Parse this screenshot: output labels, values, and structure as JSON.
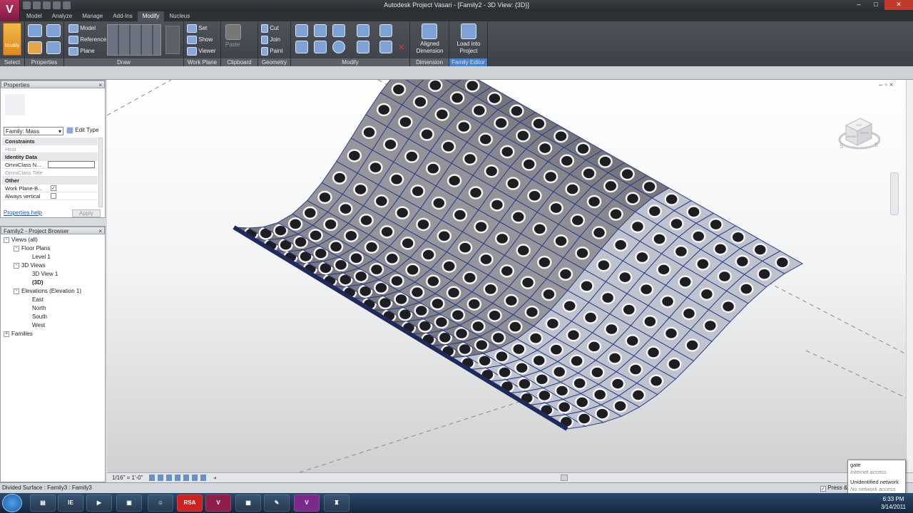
{
  "app": {
    "title": "Autodesk Project Vasari - [Family2 - 3D View: {3D}]",
    "logo": "V",
    "accent": "#8b1f4a"
  },
  "tabs": [
    "Model",
    "Analyze",
    "Manage",
    "Add-Ins",
    "Modify",
    "Nucleus"
  ],
  "ribbon": {
    "modify_label": "Modify",
    "panels": {
      "select": "Select",
      "properties": "Properties",
      "draw": "Draw",
      "work_plane": "Work Plane",
      "clipboard": "Clipboard",
      "geometry": "Geometry",
      "modify": "Modify",
      "dimension": "Dimension",
      "family_editor": "Family Editor"
    },
    "draw_items": [
      "Model",
      "Reference",
      "Plane"
    ],
    "workplane_items": [
      "Set",
      "Show",
      "Viewer"
    ],
    "clipboard_items": [
      "Paste"
    ],
    "geometry_items": [
      "Cut",
      "Join",
      "Paint"
    ],
    "aligned_dimension": "Aligned\nDimension",
    "load_into_project": "Load into\nProject"
  },
  "properties": {
    "header": "Properties",
    "type_selector": "Family: Mass",
    "edit_type": "Edit Type",
    "rows": [
      {
        "label": "Constraints",
        "group": true
      },
      {
        "label": "Host",
        "gray": true
      },
      {
        "label": "Identity Data",
        "group": true
      },
      {
        "label": "OmniClass N..."
      },
      {
        "label": "OmniClass Title",
        "gray": true
      },
      {
        "label": "Other",
        "group": true
      },
      {
        "label": "Work Plane-B...",
        "checked": true
      },
      {
        "label": "Always vertical",
        "checked": false
      }
    ],
    "help": "Properties help",
    "apply": "Apply"
  },
  "browser": {
    "header": "Family2 - Project Browser",
    "nodes": [
      {
        "label": "Views (all)",
        "level": 0,
        "toggle": "-"
      },
      {
        "label": "Floor Plans",
        "level": 1,
        "toggle": "-"
      },
      {
        "label": "Level 1",
        "level": 2
      },
      {
        "label": "3D Views",
        "level": 1,
        "toggle": "-"
      },
      {
        "label": "3D View 1",
        "level": 2
      },
      {
        "label": "(3D)",
        "level": 2,
        "bold": true
      },
      {
        "label": "Elevations (Elevation 1)",
        "level": 1,
        "toggle": "-"
      },
      {
        "label": "East",
        "level": 2
      },
      {
        "label": "North",
        "level": 2
      },
      {
        "label": "South",
        "level": 2
      },
      {
        "label": "West",
        "level": 2
      },
      {
        "label": "Families",
        "level": 0,
        "toggle": "+"
      }
    ]
  },
  "viewbar": {
    "scale": "1/16\" = 1'-0\""
  },
  "status": {
    "text": "Divided Surface : Family3 : Family3",
    "press_drag": "Press & Drag"
  },
  "viewcube": {
    "faces": [
      "TOP",
      "FRONT",
      "RIGHT"
    ],
    "compass": [
      "S",
      "E"
    ]
  },
  "network_tip": {
    "line1": "gate",
    "line2": "Internet access",
    "line3": "Unidentified network",
    "line4": "No network access"
  },
  "taskbar": {
    "apps": [
      "IE",
      "Media",
      "Folder",
      "Game",
      "RSA",
      "Vasari",
      "Calc",
      "Draw",
      "Vasari2",
      "Tool"
    ],
    "time": "6:33 PM",
    "date": "3/14/2011"
  }
}
